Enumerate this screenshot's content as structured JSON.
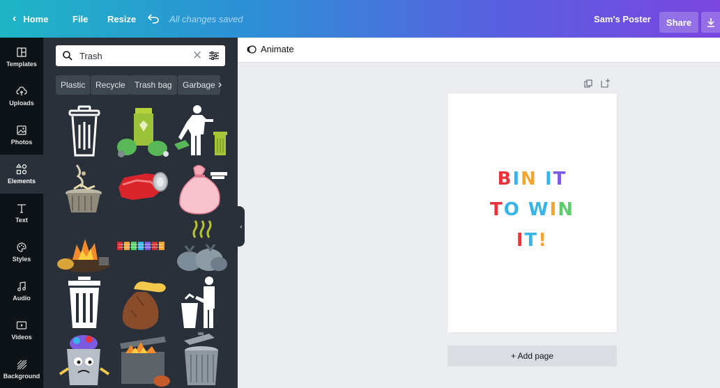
{
  "topbar": {
    "home_label": "Home",
    "file_label": "File",
    "resize_label": "Resize",
    "saved_status": "All changes saved",
    "doc_title": "Sam's Poster",
    "share_label": "Share"
  },
  "rail": {
    "items": [
      {
        "label": "Templates",
        "icon": "templates-icon"
      },
      {
        "label": "Uploads",
        "icon": "cloud-upload-icon"
      },
      {
        "label": "Photos",
        "icon": "photo-icon"
      },
      {
        "label": "Elements",
        "icon": "shapes-icon",
        "active": true
      },
      {
        "label": "Text",
        "icon": "text-icon"
      },
      {
        "label": "Styles",
        "icon": "palette-icon"
      },
      {
        "label": "Audio",
        "icon": "music-note-icon"
      },
      {
        "label": "Videos",
        "icon": "video-icon"
      },
      {
        "label": "Background",
        "icon": "background-pattern-icon"
      }
    ]
  },
  "panel": {
    "search": {
      "value": "Trash"
    },
    "chips": [
      "Plastic",
      "Recycle",
      "Trash bag",
      "Garbage"
    ],
    "results": [
      "outline-trash-can",
      "recycling-bin-with-bags",
      "person-throwing-trash",
      "smoking-trash-can",
      "crushed-red-can",
      "pink-trash-bag",
      "burning-garbage-pile",
      "row-of-colored-bins",
      "smelly-garbage-bags",
      "white-trash-can",
      "brown-trash-bag",
      "person-at-trash-can",
      "overflowing-trash-can-character",
      "burning-dumpster",
      "metal-trash-can"
    ]
  },
  "editor": {
    "animate_label": "Animate",
    "add_page_label": "+ Add page",
    "poster_lines": [
      {
        "text": "BIN IT",
        "colors": [
          "#e8343a",
          "#37b4e8",
          "#f2a533",
          "#ffffff",
          "#7b5ce0",
          "#f26b3a"
        ]
      },
      {
        "text": "TO WIN",
        "colors": [
          "#e8343a",
          "#37b4e8",
          "#ffffff",
          "#f2a533",
          "#5ccf6c",
          "#7b5ce0"
        ]
      },
      {
        "text": "IT!",
        "colors": [
          "#e8343a",
          "#37b4e8",
          "#f2a533"
        ]
      }
    ]
  }
}
